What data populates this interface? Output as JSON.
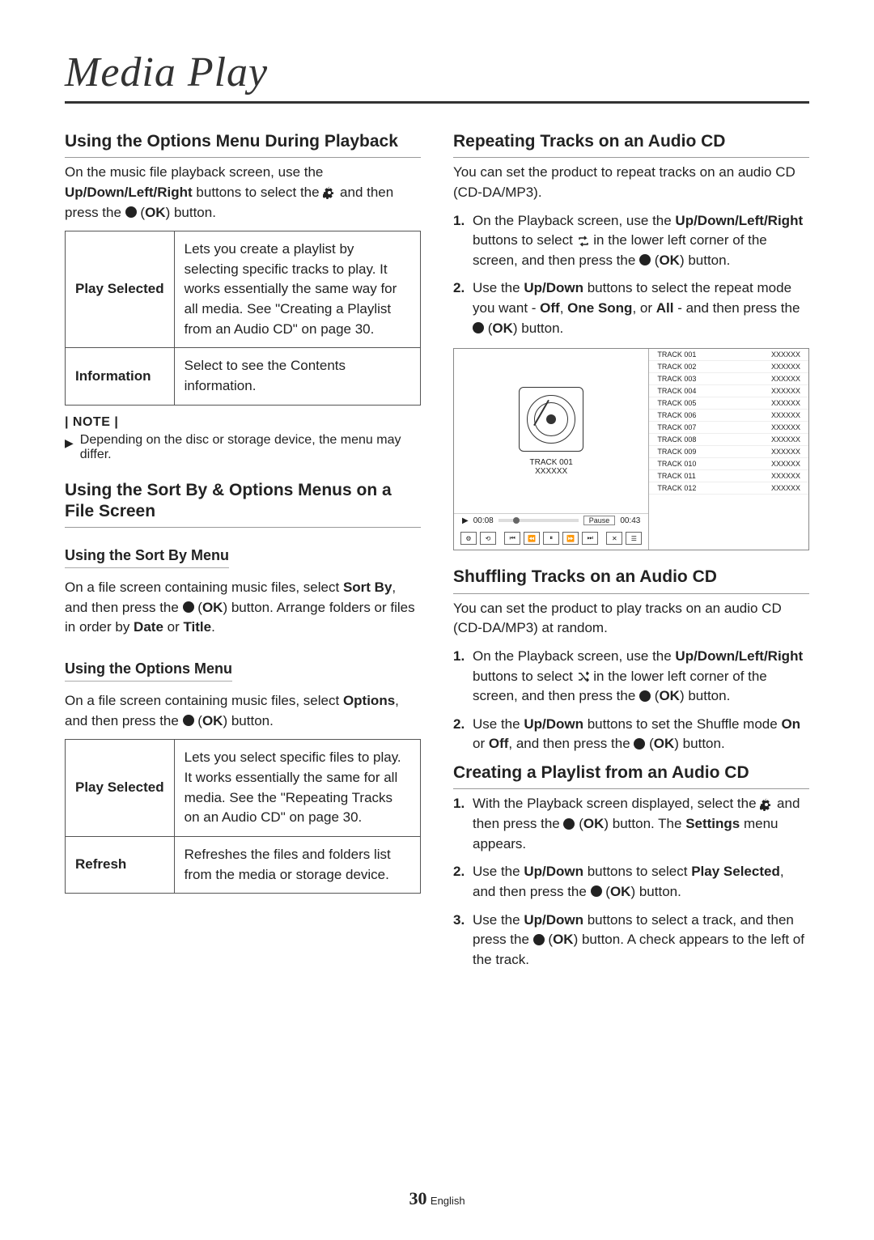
{
  "page": {
    "title": "Media Play",
    "number": "30",
    "lang": "English"
  },
  "left": {
    "h1": "Using the Options Menu During Playback",
    "p1_a": "On the music file playback screen, use the ",
    "p1_b": "Up/Down/Left/Right",
    "p1_c": " buttons to select the ",
    "p1_d": " and then press the ",
    "p1_ok": "OK",
    "p1_e": ") button.",
    "table1": {
      "row1": {
        "th": "Play Selected",
        "td": "Lets you create a playlist by selecting specific tracks to play. It works essentially the same way for all media. See \"Creating a Playlist from an Audio CD\" on page 30."
      },
      "row2": {
        "th": "Information",
        "td": "Select to see the Contents information."
      }
    },
    "note_label": "| NOTE |",
    "note_body": "Depending on the disc or storage device, the menu may differ.",
    "h2": "Using the Sort By & Options Menus on a File Screen",
    "h3a": "Using the Sort By Menu",
    "p2_a": "On a file screen containing music files, select ",
    "p2_b": "Sort By",
    "p2_c": ", and then press the ",
    "p2_ok": "OK",
    "p2_d": ") button. Arrange folders or files in order by ",
    "p2_date": "Date",
    "p2_or": " or ",
    "p2_title": "Title",
    "p2_e": ".",
    "h3b": "Using the Options Menu",
    "p3_a": "On a file screen containing music files, select ",
    "p3_b": "Options",
    "p3_c": ", and then press the ",
    "p3_ok": "OK",
    "p3_d": ") button.",
    "table2": {
      "row1": {
        "th": "Play Selected",
        "td": "Lets you select specific files to play. It works essentially the same for all media. See the \"Repeating Tracks on an Audio CD\" on page 30."
      },
      "row2": {
        "th": "Refresh",
        "td": "Refreshes the files and folders list from the media or storage device."
      }
    }
  },
  "right": {
    "h1": "Repeating Tracks on an Audio CD",
    "p1": "You can set the product to repeat tracks on an audio CD (CD-DA/MP3).",
    "ol1": {
      "i1_a": "On the Playback screen, use the ",
      "i1_b": "Up/Down/Left/Right",
      "i1_c": " buttons to select ",
      "i1_d": " in the lower left corner of the screen, and then press the ",
      "i1_ok": "OK",
      "i1_e": ") button.",
      "i2_a": "Use the ",
      "i2_b": "Up/Down",
      "i2_c": " buttons to select the repeat mode you want - ",
      "i2_off": "Off",
      "i2_s1": ", ",
      "i2_one": "One Song",
      "i2_s2": ", or ",
      "i2_all": "All",
      "i2_d": " - and then press the ",
      "i2_ok": "OK",
      "i2_e": ") button."
    },
    "player": {
      "current_track": "TRACK 001",
      "current_sub": "XXXXXX",
      "time_a": "00:08",
      "time_b": "00:43",
      "mode": "Pause",
      "tracks": [
        {
          "t": "TRACK 001",
          "v": "XXXXXX"
        },
        {
          "t": "TRACK 002",
          "v": "XXXXXX"
        },
        {
          "t": "TRACK 003",
          "v": "XXXXXX"
        },
        {
          "t": "TRACK 004",
          "v": "XXXXXX"
        },
        {
          "t": "TRACK 005",
          "v": "XXXXXX"
        },
        {
          "t": "TRACK 006",
          "v": "XXXXXX"
        },
        {
          "t": "TRACK 007",
          "v": "XXXXXX"
        },
        {
          "t": "TRACK 008",
          "v": "XXXXXX"
        },
        {
          "t": "TRACK 009",
          "v": "XXXXXX"
        },
        {
          "t": "TRACK 010",
          "v": "XXXXXX"
        },
        {
          "t": "TRACK 011",
          "v": "XXXXXX"
        },
        {
          "t": "TRACK 012",
          "v": "XXXXXX"
        }
      ]
    },
    "h2": "Shuffling Tracks on an Audio CD",
    "p2": "You can set the product to play tracks on an audio CD (CD-DA/MP3) at random.",
    "ol2": {
      "i1_a": "On the Playback screen, use the ",
      "i1_b": "Up/Down/Left/Right",
      "i1_c": " buttons to select ",
      "i1_d": " in the lower left corner of the screen, and then press the ",
      "i1_ok": "OK",
      "i1_e": ") button.",
      "i2_a": "Use the ",
      "i2_b": "Up/Down",
      "i2_c": " buttons to set the Shuffle mode ",
      "i2_on": "On",
      "i2_or": " or ",
      "i2_off": "Off",
      "i2_d": ", and then press the ",
      "i2_ok": "OK",
      "i2_e": ") button."
    },
    "h3": "Creating a Playlist from an Audio CD",
    "ol3": {
      "i1_a": "With the Playback screen displayed, select the ",
      "i1_b": " and then press the ",
      "i1_ok": "OK",
      "i1_c": ") button. The ",
      "i1_set": "Settings",
      "i1_d": " menu appears.",
      "i2_a": "Use the ",
      "i2_b": "Up/Down",
      "i2_c": " buttons to select ",
      "i2_ps": "Play Selected",
      "i2_d": ", and then press the ",
      "i2_ok": "OK",
      "i2_e": ") button.",
      "i3_a": "Use the ",
      "i3_b": "Up/Down",
      "i3_c": " buttons to select a track, and then press the ",
      "i3_ok": "OK",
      "i3_d": ") button. A check appears to the left of the track."
    }
  }
}
